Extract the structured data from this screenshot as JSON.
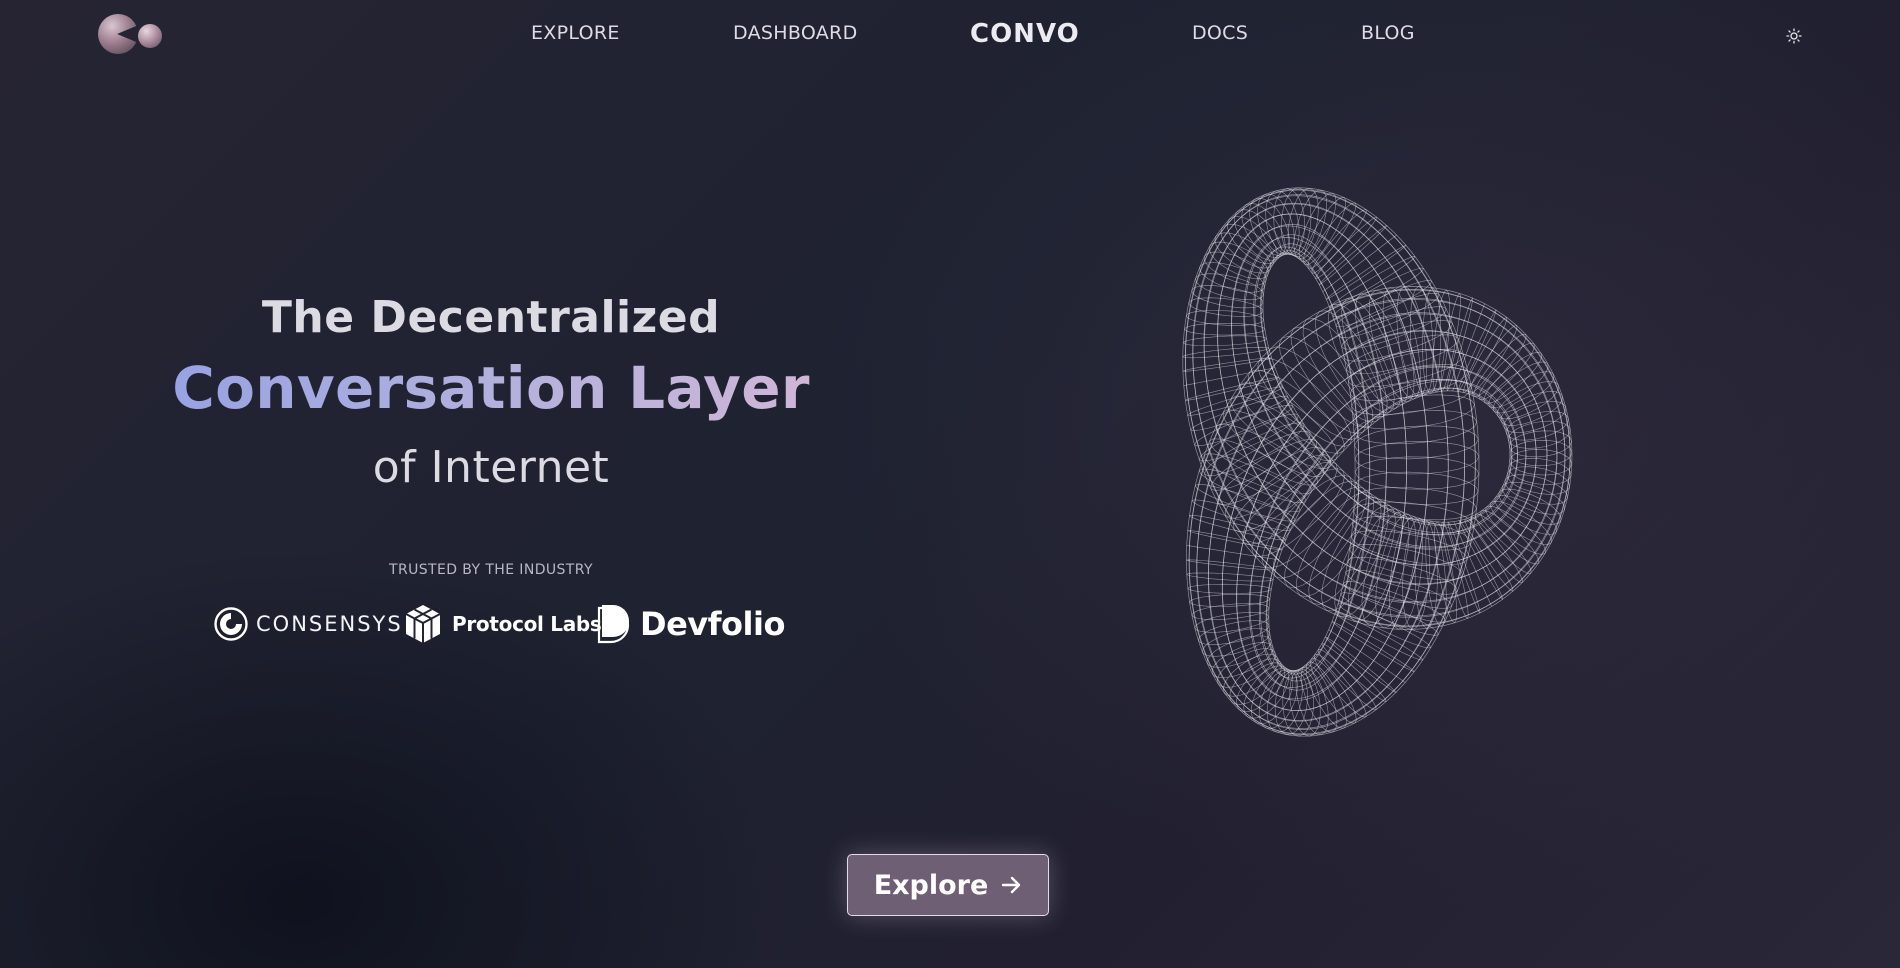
{
  "nav": {
    "items": [
      {
        "label": "EXPLORE"
      },
      {
        "label": "DASHBOARD"
      },
      {
        "label": "CONVO"
      },
      {
        "label": "DOCS"
      },
      {
        "label": "BLOG"
      }
    ],
    "theme_icon": "sun-icon"
  },
  "hero": {
    "line1": "The Decentralized",
    "line2": "Conversation Layer",
    "line3": "of Internet",
    "gradient_colors": [
      "#8a9ce6",
      "#b6b2dc",
      "#e0b8d4"
    ]
  },
  "trusted": {
    "label": "TRUSTED BY THE INDUSTRY",
    "partners": [
      {
        "name": "CONSENSYS",
        "icon": "consensys-logo-icon"
      },
      {
        "name": "Protocol Labs",
        "icon": "protocol-labs-logo-icon"
      },
      {
        "name": "Devfolio",
        "icon": "devfolio-logo-icon"
      }
    ]
  },
  "cta": {
    "label": "Explore",
    "icon": "arrow-right-icon",
    "background": "#6f5f74"
  },
  "colors": {
    "background": "#222030",
    "text": "#dcdbe3"
  }
}
